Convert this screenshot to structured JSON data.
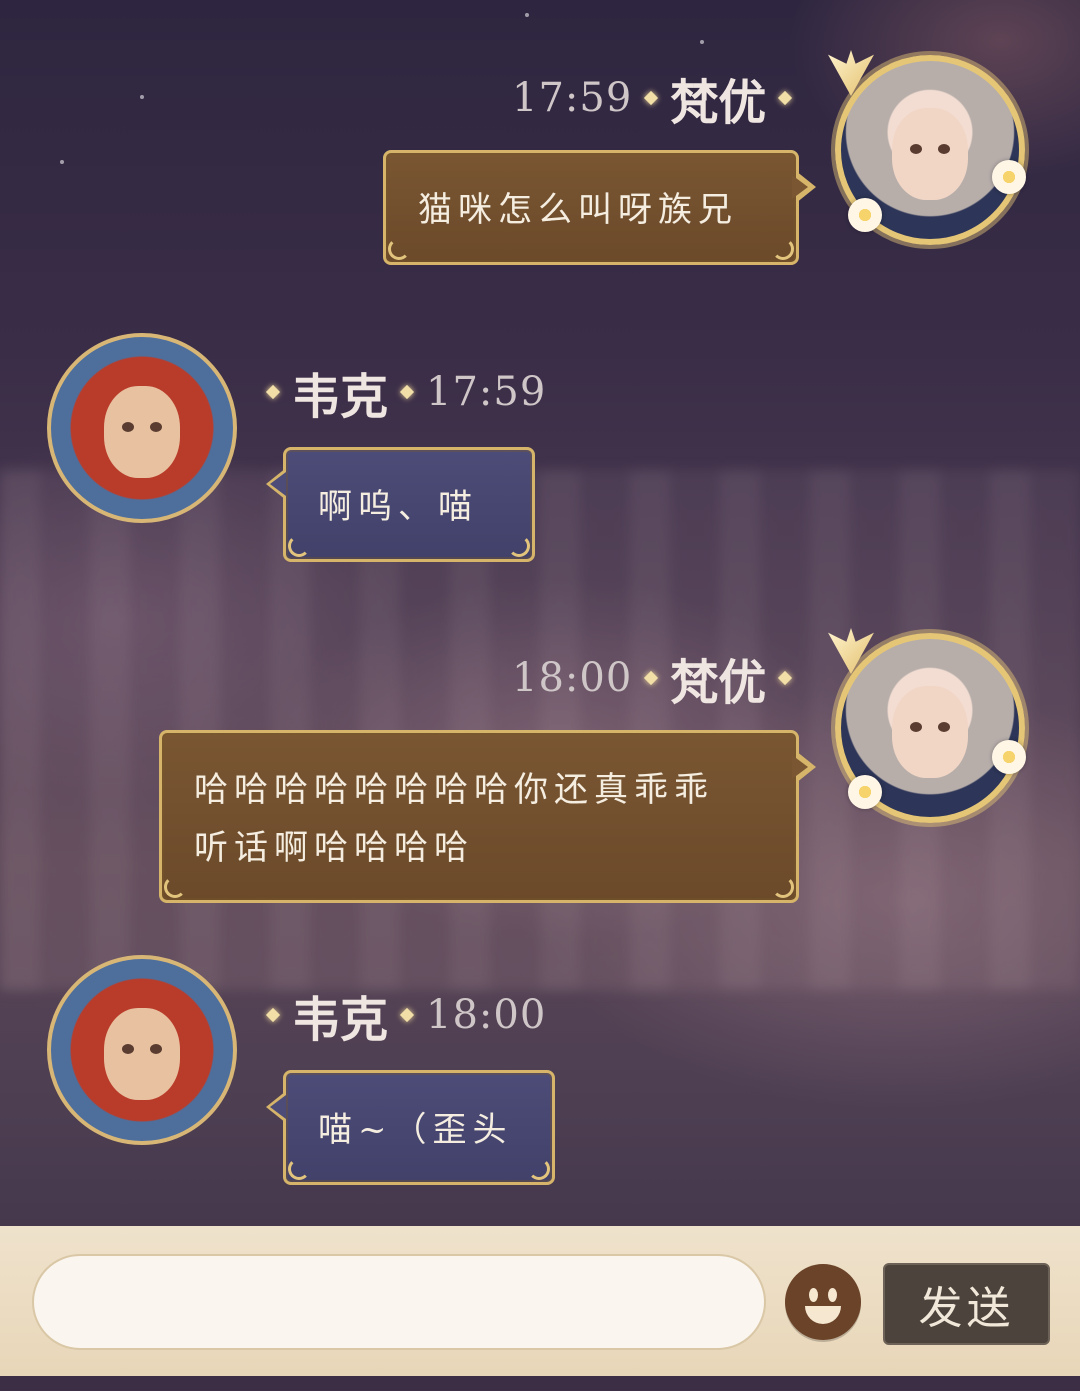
{
  "messages": [
    {
      "side": "right",
      "time": "17:59",
      "name": "梵优",
      "text": "猫咪怎么叫呀族兄"
    },
    {
      "side": "left",
      "time": "17:59",
      "name": "韦克",
      "text": "啊呜、喵"
    },
    {
      "side": "right",
      "time": "18:00",
      "name": "梵优",
      "text_line1": "哈哈哈哈哈哈哈哈你还真乖乖",
      "text_line2": "听话啊哈哈哈哈"
    },
    {
      "side": "left",
      "time": "18:00",
      "name": "韦克",
      "text": "喵~（歪头"
    }
  ],
  "input": {
    "placeholder": "",
    "value": ""
  },
  "controls": {
    "send_label": "发送",
    "emoji_icon": "smiley-face-icon"
  },
  "colors": {
    "right_bubble": "#7a5632",
    "left_bubble": "#4d4c78",
    "bubble_border": "#d6b56a",
    "input_bar": "#efe2cc"
  }
}
